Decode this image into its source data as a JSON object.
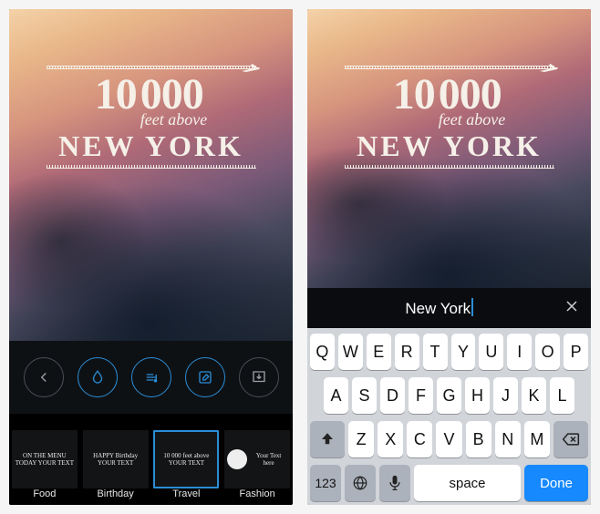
{
  "photo_overlay": {
    "line1_a": "10",
    "line1_b": "000",
    "subline": "feet above",
    "city": "NEW YORK",
    "icon": "plane-icon"
  },
  "toolbar": [
    {
      "name": "back-button",
      "icon": "arrow-left-icon",
      "active": false
    },
    {
      "name": "effects-button",
      "icon": "drop-icon",
      "active": true
    },
    {
      "name": "music-button",
      "icon": "music-lines-icon",
      "active": true
    },
    {
      "name": "edit-button",
      "icon": "compose-icon",
      "active": true
    },
    {
      "name": "save-button",
      "icon": "download-icon",
      "active": false
    }
  ],
  "templates": [
    {
      "name": "template-food",
      "label": "Food",
      "preview": "ON THE MENU TODAY\nYOUR TEXT"
    },
    {
      "name": "template-birthday",
      "label": "Birthday",
      "preview": "HAPPY\nBirthday\nYOUR TEXT"
    },
    {
      "name": "template-travel",
      "label": "Travel",
      "preview": "10 000 feet above\nYOUR TEXT",
      "selected": true
    },
    {
      "name": "template-fashion",
      "label": "Fashion",
      "preview": "Your Text here"
    }
  ],
  "input": {
    "value": "New York",
    "close_icon": "close-icon"
  },
  "keyboard": {
    "row1": [
      "Q",
      "W",
      "E",
      "R",
      "T",
      "Y",
      "U",
      "I",
      "O",
      "P"
    ],
    "row2": [
      "A",
      "S",
      "D",
      "F",
      "G",
      "H",
      "J",
      "K",
      "L"
    ],
    "row3": [
      "Z",
      "X",
      "C",
      "V",
      "B",
      "N",
      "M"
    ],
    "num_label": "123",
    "space_label": "space",
    "done_label": "Done"
  }
}
